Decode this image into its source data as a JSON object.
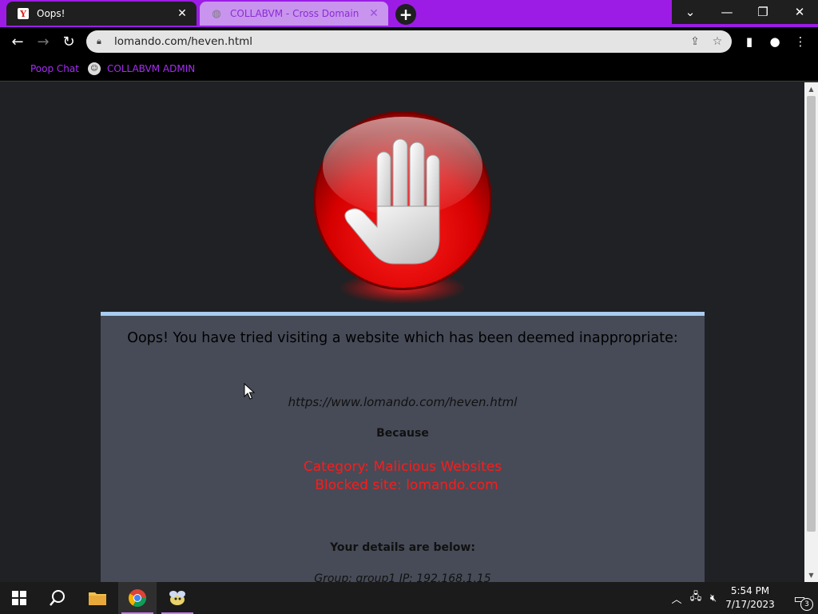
{
  "tabs": [
    {
      "title": "Oops!",
      "favicon": "yandex-y-icon",
      "active": true
    },
    {
      "title": "COLLABVM - Cross Domain",
      "favicon": "globe-icon",
      "active": false
    }
  ],
  "toolbar": {
    "url": "lomando.com/heven.html"
  },
  "bookmarks": [
    {
      "label": "Poop Chat"
    },
    {
      "label": "COLLABVM ADMIN"
    }
  ],
  "page": {
    "headline": "Oops! You have tried visiting a website which has been deemed inappropriate:",
    "blocked_url": "https://www.lomando.com/heven.html",
    "because": "Because",
    "category": "Category: Malicious Websites",
    "blocked_site": "Blocked site: lomando.com",
    "details_heading": "Your details are below:",
    "group_line": "Group: group1   IP: 192.168.1.15"
  },
  "taskbar": {
    "time": "5:54 PM",
    "date": "7/17/2023",
    "notification_count": "3"
  },
  "colors": {
    "accent": "#9c1ce6",
    "panel": "#464b57",
    "warning_text": "#ff1a1a"
  }
}
